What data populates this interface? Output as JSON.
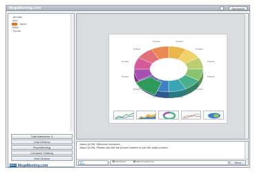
{
  "window": {
    "title": "MegaMeeting.com",
    "top_button": "Bandwidth"
  },
  "attendees": [
    "Jennifer",
    "Alex",
    "Jason",
    "Mark",
    "Tyrone"
  ],
  "panel_buttons": [
    "Total Attendees: 5",
    "Chat Window",
    "Show/Meeting",
    "Computer Sharing",
    "Host Options"
  ],
  "brand": {
    "logo": "MEGA",
    "name": "MegaMeeting.com"
  },
  "slide": {
    "segment_colors": [
      "#e8b64a",
      "#f0d26a",
      "#b9cf6f",
      "#8ac46c",
      "#4bb08a",
      "#3aa6b4",
      "#3f7fc3",
      "#6a5bb8",
      "#a64fb0",
      "#d45a9a",
      "#e2707a",
      "#e88a52"
    ],
    "segment_labels": [
      "Product",
      "Product",
      "Product",
      "Product",
      "Product",
      "Product",
      "Product",
      "Product",
      "Product",
      "Product",
      "Product",
      "Product"
    ]
  },
  "chat": {
    "lines": [
      "Jason (4:09): Welcome everyone.",
      "Jason (4:09): Please call into the phone number to join the audio portion."
    ],
    "recipient": "Alex",
    "recipient_sub": "Jason",
    "checkbox_1": "Full Screen",
    "checkbox_2": "Submit to Everyone",
    "send_label": "Send"
  },
  "colors": {
    "brand_blue": "#1f5fa8",
    "accent_orange": "#e2711d"
  }
}
